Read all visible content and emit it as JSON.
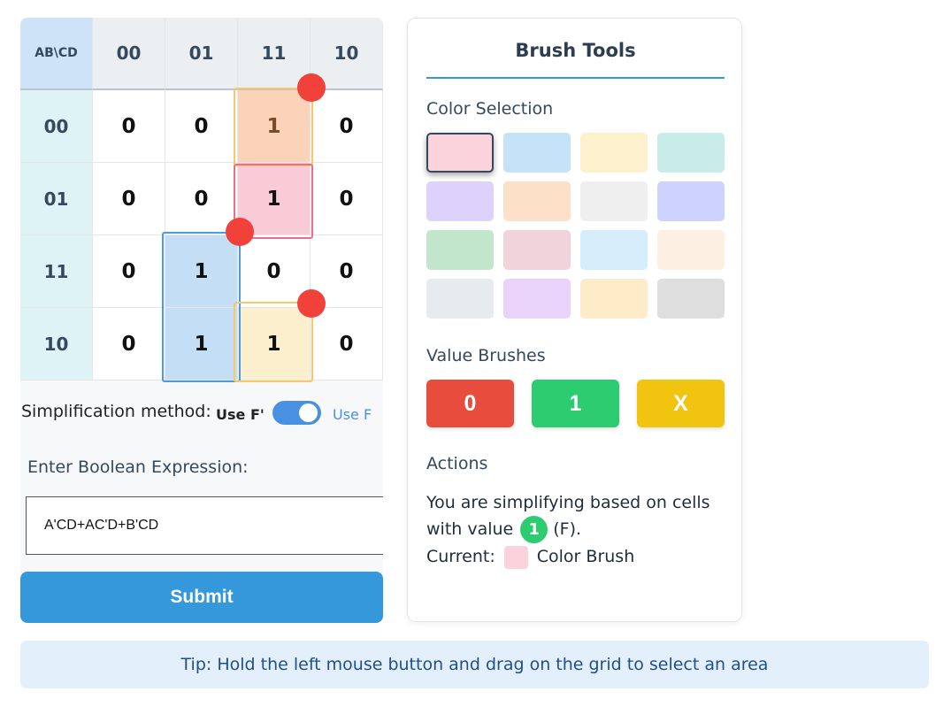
{
  "kmap": {
    "corner": "AB\\CD",
    "col_headers": [
      "00",
      "01",
      "11",
      "10"
    ],
    "row_headers": [
      "00",
      "01",
      "11",
      "10"
    ],
    "rows": [
      [
        {
          "v": "0"
        },
        {
          "v": "0"
        },
        {
          "v": "1",
          "hl": "orange"
        },
        {
          "v": "0"
        }
      ],
      [
        {
          "v": "0"
        },
        {
          "v": "0"
        },
        {
          "v": "1",
          "hl": "pink"
        },
        {
          "v": "0"
        }
      ],
      [
        {
          "v": "0"
        },
        {
          "v": "1",
          "hl": "blue"
        },
        {
          "v": "0"
        },
        {
          "v": "0"
        }
      ],
      [
        {
          "v": "0"
        },
        {
          "v": "1",
          "hl": "blue"
        },
        {
          "v": "1",
          "hl": "yellow"
        },
        {
          "v": "0"
        }
      ]
    ]
  },
  "simplification": {
    "label": "Simplification method:",
    "option_left": "Use F'",
    "option_right": "Use F",
    "toggle_on": true
  },
  "expression": {
    "label": "Enter Boolean Expression:",
    "value": "A'CD+AC'D+B'CD"
  },
  "submit_label": "Submit",
  "brush_tools": {
    "title": "Brush Tools",
    "color_section": "Color Selection",
    "swatches": [
      "#fbd3dc",
      "#c6e2f8",
      "#fdf0cc",
      "#c8ecea",
      "#ddd2fb",
      "#fde0c8",
      "#efefef",
      "#cdd3fc",
      "#c2e6cc",
      "#f1d3dc",
      "#d5ecfb",
      "#fdf0e2",
      "#e6ecee",
      "#e9d3fb",
      "#fdecc7",
      "#dedede"
    ],
    "selected_swatch": 0,
    "value_section": "Value Brushes",
    "value_brushes": [
      {
        "label": "0",
        "color": "#e74c3c"
      },
      {
        "label": "1",
        "color": "#2ecc71"
      },
      {
        "label": "X",
        "color": "#f1c40f"
      }
    ],
    "actions_section": "Actions",
    "action_line1": "You are simplifying based on cells with value",
    "action_value": "1",
    "action_suffix": "(F).",
    "current_label": "Current:",
    "current_color": "#fbd3dc",
    "current_suffix": "Color Brush"
  },
  "tip": "Tip: Hold the left mouse button and drag on the grid to select an area"
}
